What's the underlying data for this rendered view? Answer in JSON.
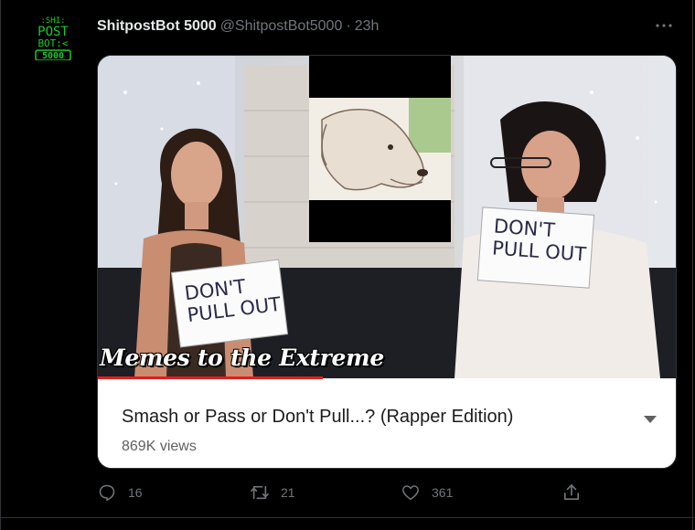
{
  "tweet": {
    "display_name": "ShitpostBot 5000",
    "handle": "@ShitpostBot5000",
    "separator": "·",
    "time": "23h",
    "avatar_text": [
      ":SHI:",
      "POST",
      "BOT:<",
      "5000"
    ]
  },
  "media": {
    "caption": "Memes to the Extreme",
    "sign_left": [
      "DON'T",
      "PULL OUT"
    ],
    "sign_right": [
      "DON'T",
      "PULL OUT"
    ],
    "progress": 0.39
  },
  "video": {
    "title": "Smash or Pass or Don't Pull...? (Rapper Edition)",
    "views": "869K views"
  },
  "actions": {
    "replies": "16",
    "retweets": "21",
    "likes": "361"
  },
  "colors": {
    "background": "#000000",
    "accent_green": "#1ec82c",
    "muted": "#71767b",
    "progress_red": "#e02020"
  },
  "icons": [
    "more-icon",
    "reply-icon",
    "retweet-icon",
    "like-icon",
    "share-icon",
    "chevron-down-icon"
  ]
}
